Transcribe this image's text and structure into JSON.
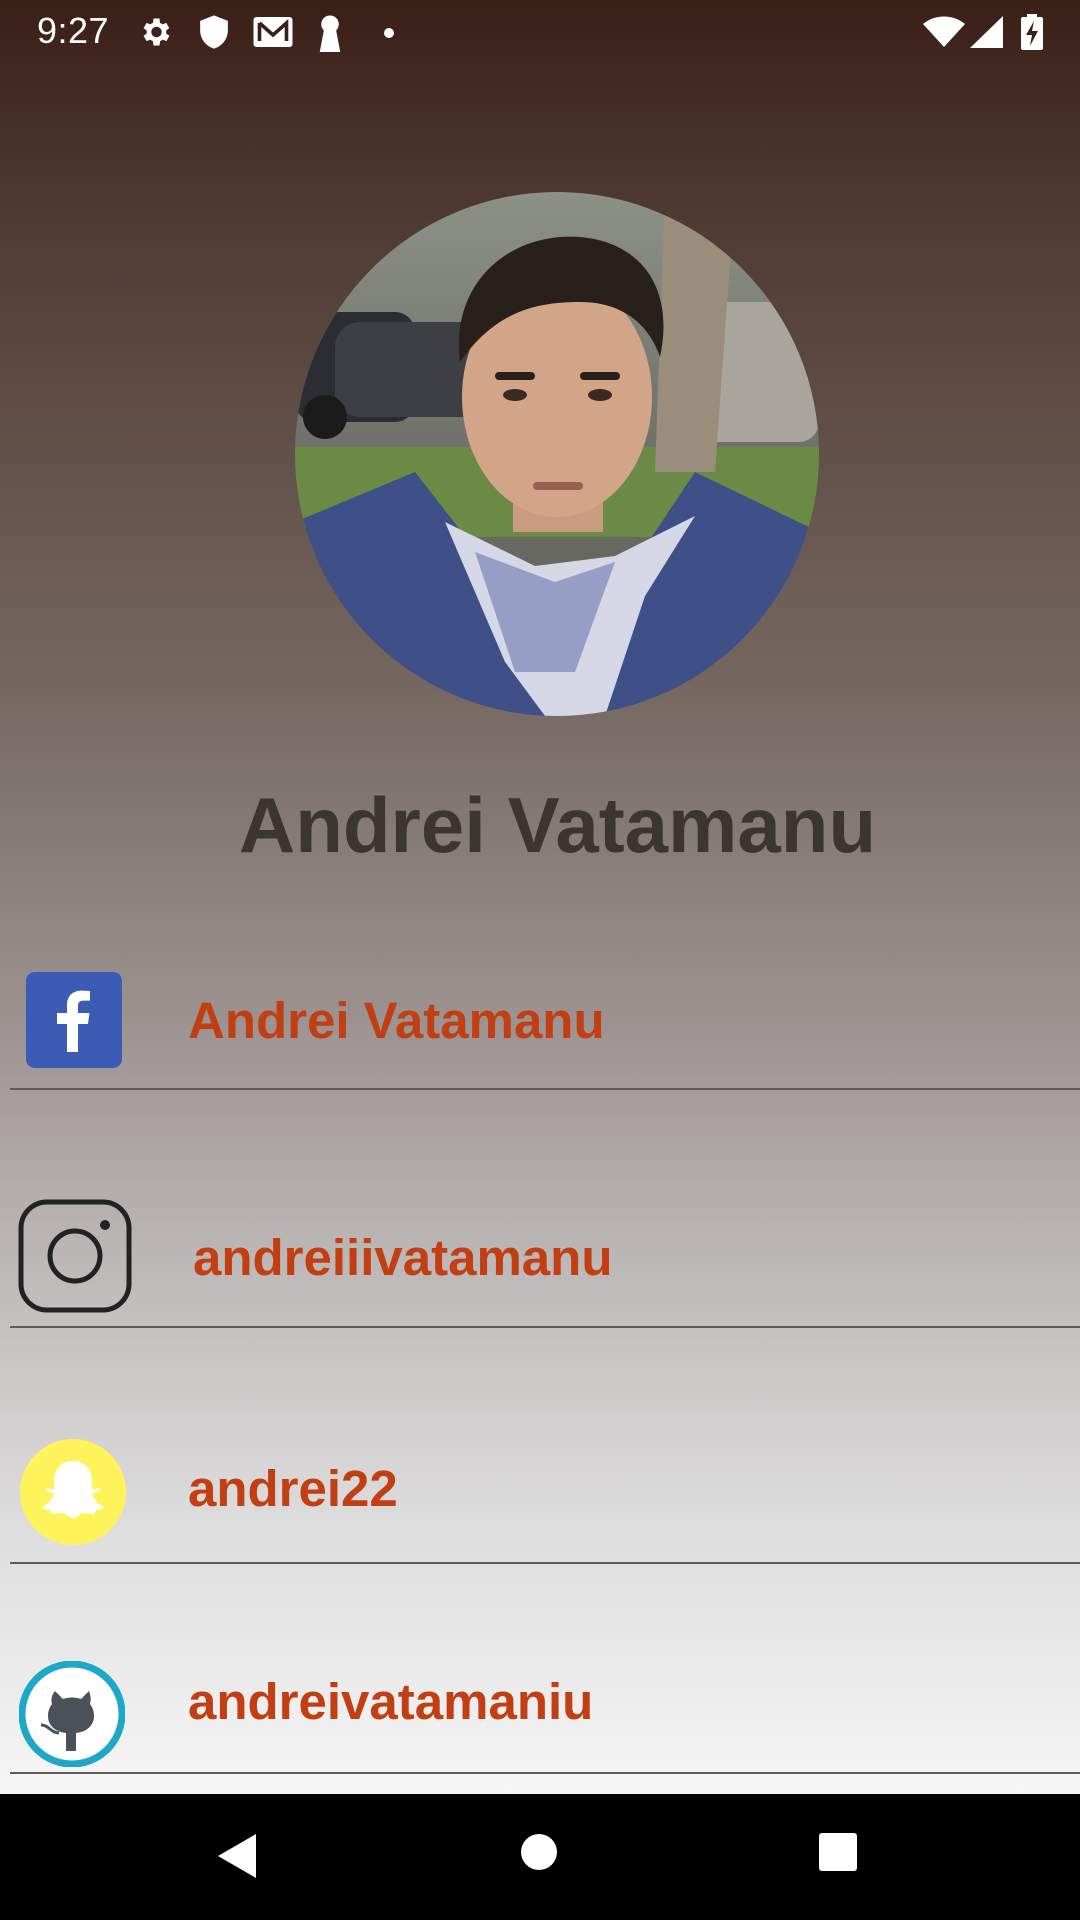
{
  "status_bar": {
    "time": "9:27",
    "left_icons": [
      "gear-icon",
      "shield-icon",
      "mail-icon",
      "keyhole-icon",
      "dot-icon"
    ],
    "right_icons": [
      "wifi-icon",
      "signal-icon",
      "battery-charging-icon"
    ]
  },
  "profile": {
    "name": "Andrei Vatamanu",
    "avatar": "profile-photo"
  },
  "social": [
    {
      "service": "facebook",
      "icon": "facebook-icon",
      "label": "Andrei Vatamanu",
      "icon_color": "#3b5bb5"
    },
    {
      "service": "instagram",
      "icon": "instagram-icon",
      "label": "andreiiivatamanu",
      "icon_color": "#222222"
    },
    {
      "service": "snapchat",
      "icon": "snapchat-icon",
      "label": "andrei22",
      "icon_color": "#fff35c"
    },
    {
      "service": "github",
      "icon": "github-icon",
      "label": "andreivatamaniu",
      "icon_color": "#1ea7c6"
    }
  ],
  "colors": {
    "label": "#c13f12",
    "name": "#3d3532",
    "divider": "#5f5a59"
  },
  "nav_bar": [
    "back-icon",
    "home-icon",
    "recents-icon"
  ]
}
